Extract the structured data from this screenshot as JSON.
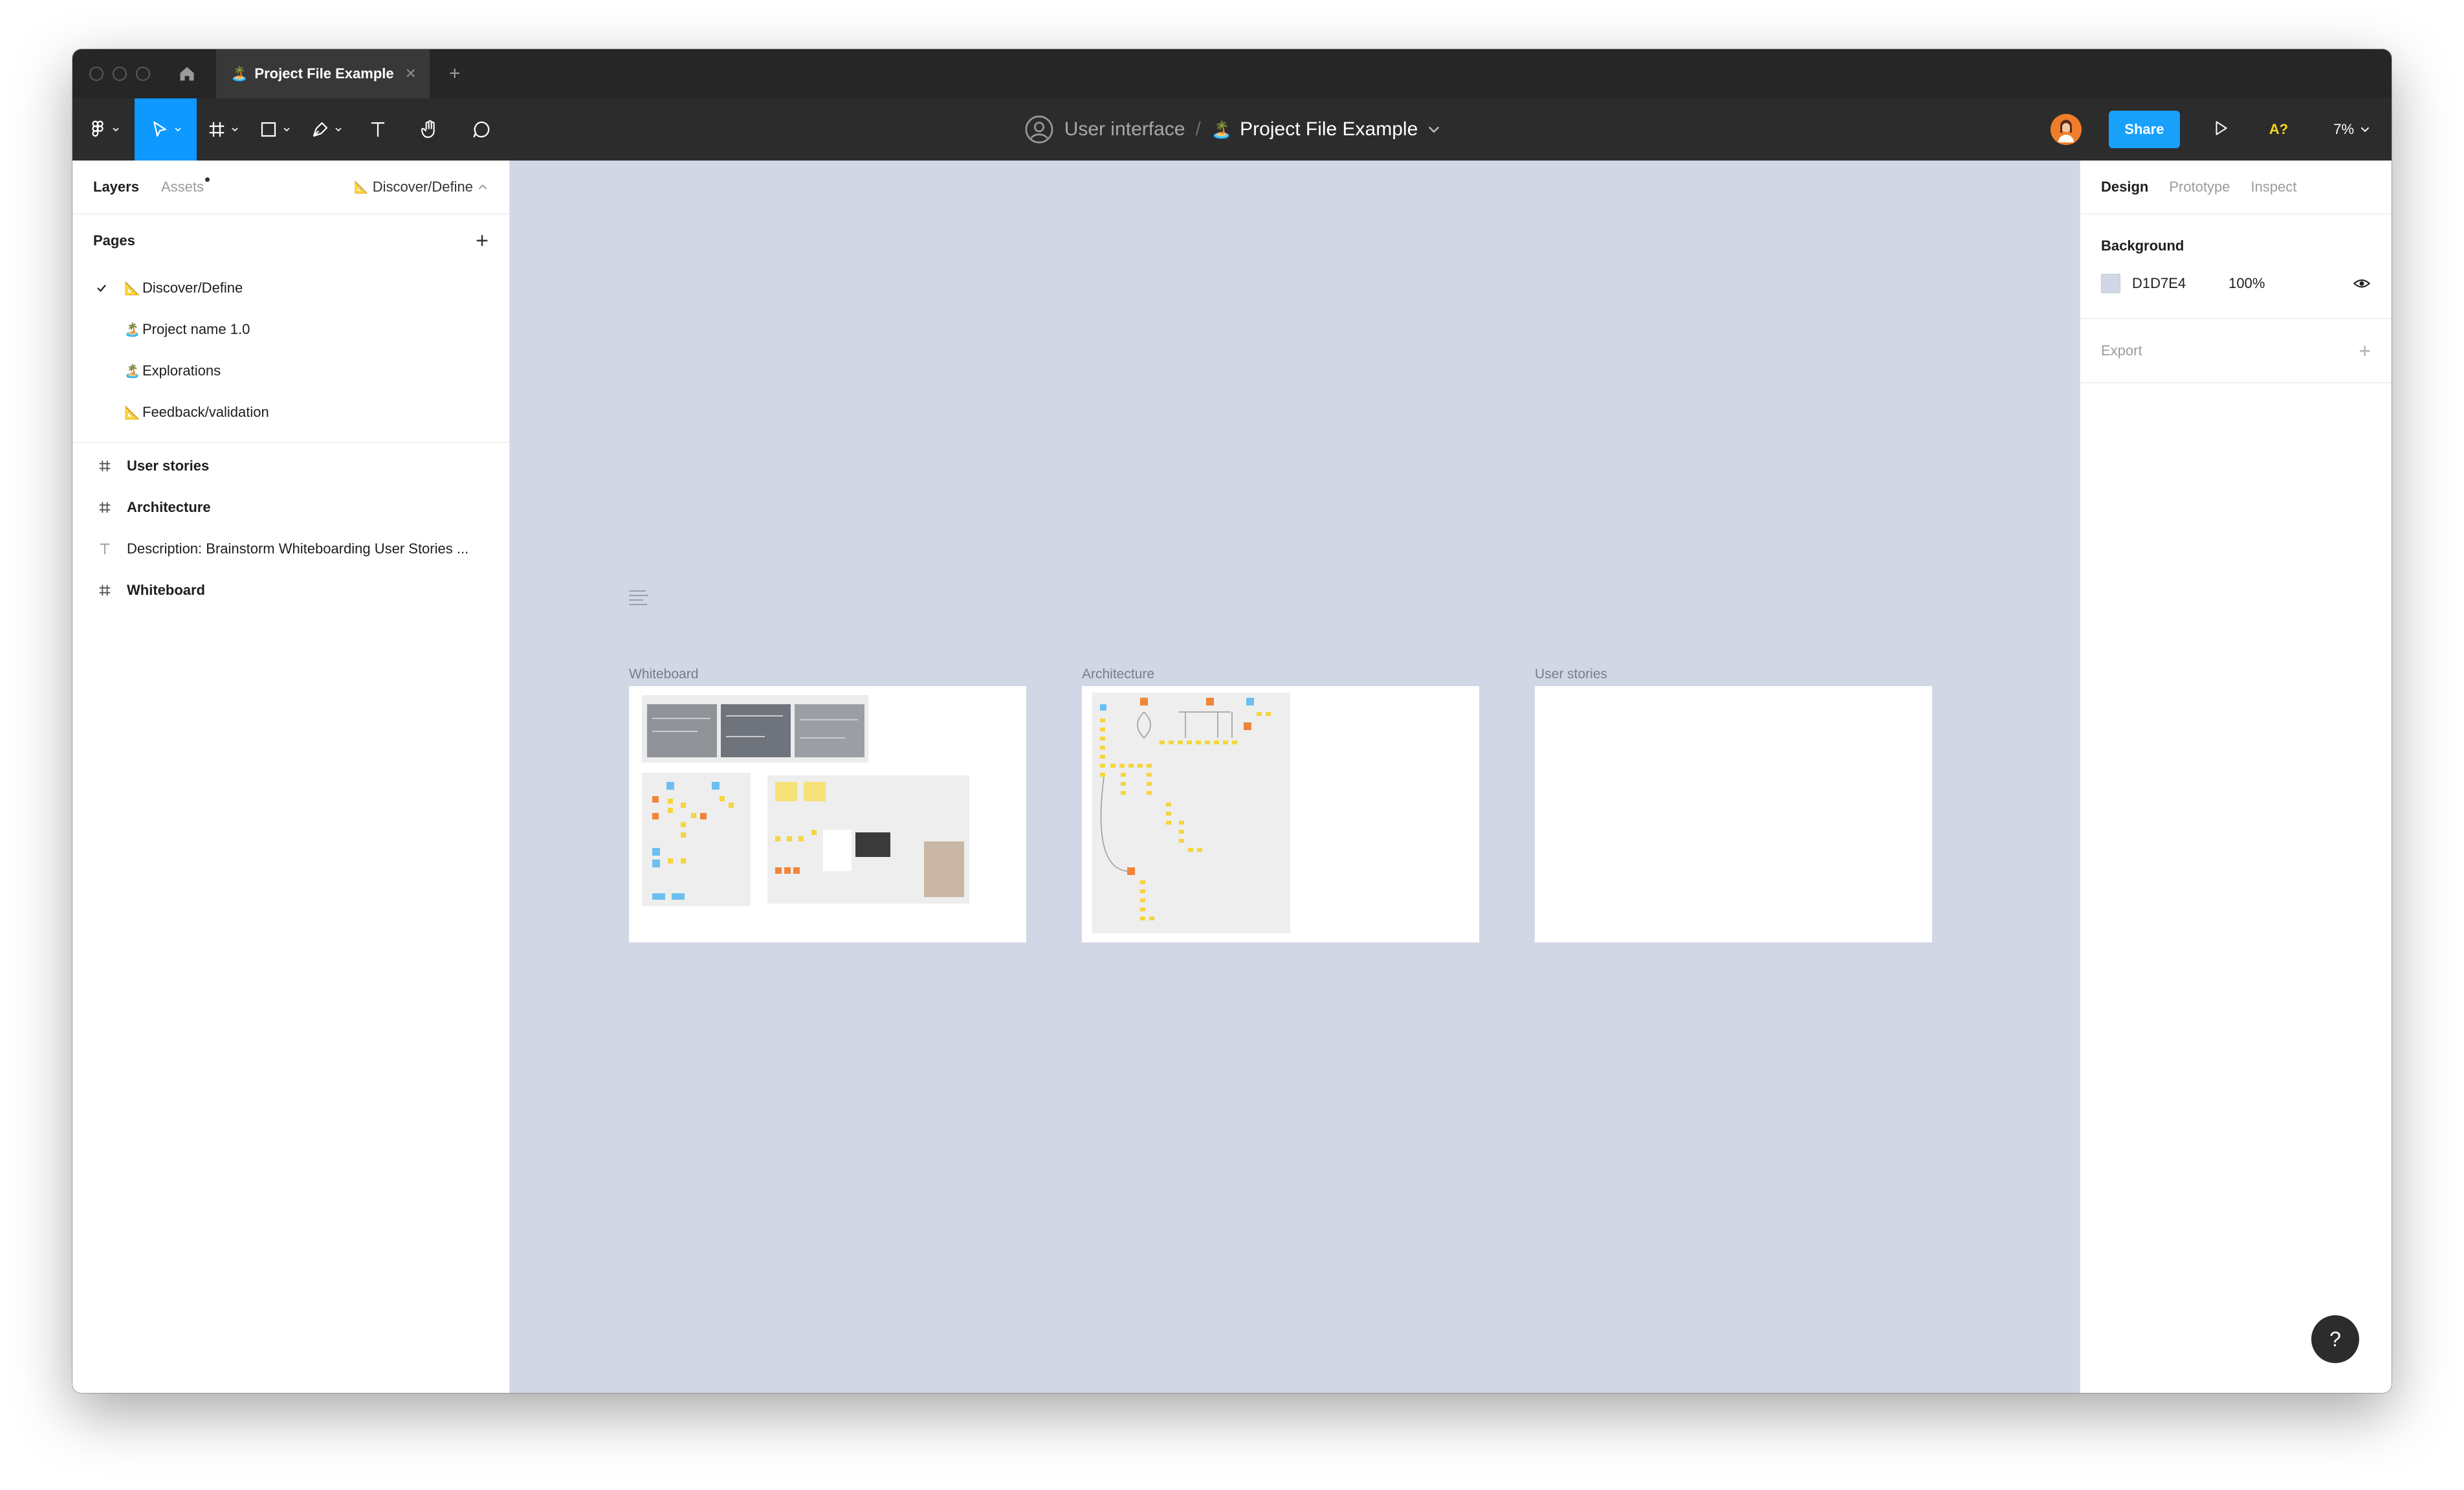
{
  "window": {
    "tab_title": "Project File Example",
    "tab_emoji": "🏝️"
  },
  "toolbar": {
    "team_name": "User interface",
    "file_separator": "/",
    "file_emoji": "🏝️",
    "file_name": "Project File Example",
    "share_label": "Share",
    "a11y_label": "A?",
    "zoom_label": "7%"
  },
  "left_panel": {
    "tabs": {
      "layers": "Layers",
      "assets": "Assets"
    },
    "current_page": "Discover/Define",
    "pages_heading": "Pages",
    "pages": [
      {
        "emoji": "📐",
        "label": "Discover/Define",
        "selected": true
      },
      {
        "emoji": "🏝️",
        "label": "Project name 1.0",
        "selected": false
      },
      {
        "emoji": "🏝️",
        "label": "Explorations",
        "selected": false
      },
      {
        "emoji": "📐",
        "label": "Feedback/validation",
        "selected": false
      }
    ],
    "layers": [
      {
        "type": "frame",
        "label": "User stories"
      },
      {
        "type": "frame",
        "label": "Architecture"
      },
      {
        "type": "text",
        "label": "Description: Brainstorm Whiteboarding User Stories ..."
      },
      {
        "type": "frame",
        "label": "Whiteboard"
      }
    ]
  },
  "canvas": {
    "background": "#D1D7E4",
    "frames": [
      {
        "label": "Whiteboard"
      },
      {
        "label": "Architecture"
      },
      {
        "label": "User stories"
      }
    ]
  },
  "right_panel": {
    "tabs": {
      "design": "Design",
      "prototype": "Prototype",
      "inspect": "Inspect"
    },
    "background_heading": "Background",
    "background_hex": "D1D7E4",
    "background_opacity": "100%",
    "export_label": "Export",
    "help_label": "?"
  },
  "colors": {
    "accent": "#0D99FF",
    "share": "#18A0FB",
    "toolbar": "#2C2C2C",
    "titlebar": "#262626",
    "sticky_yellow": "#F5D53B",
    "sticky_orange": "#F0853A",
    "sticky_blue": "#6CC0F0"
  }
}
